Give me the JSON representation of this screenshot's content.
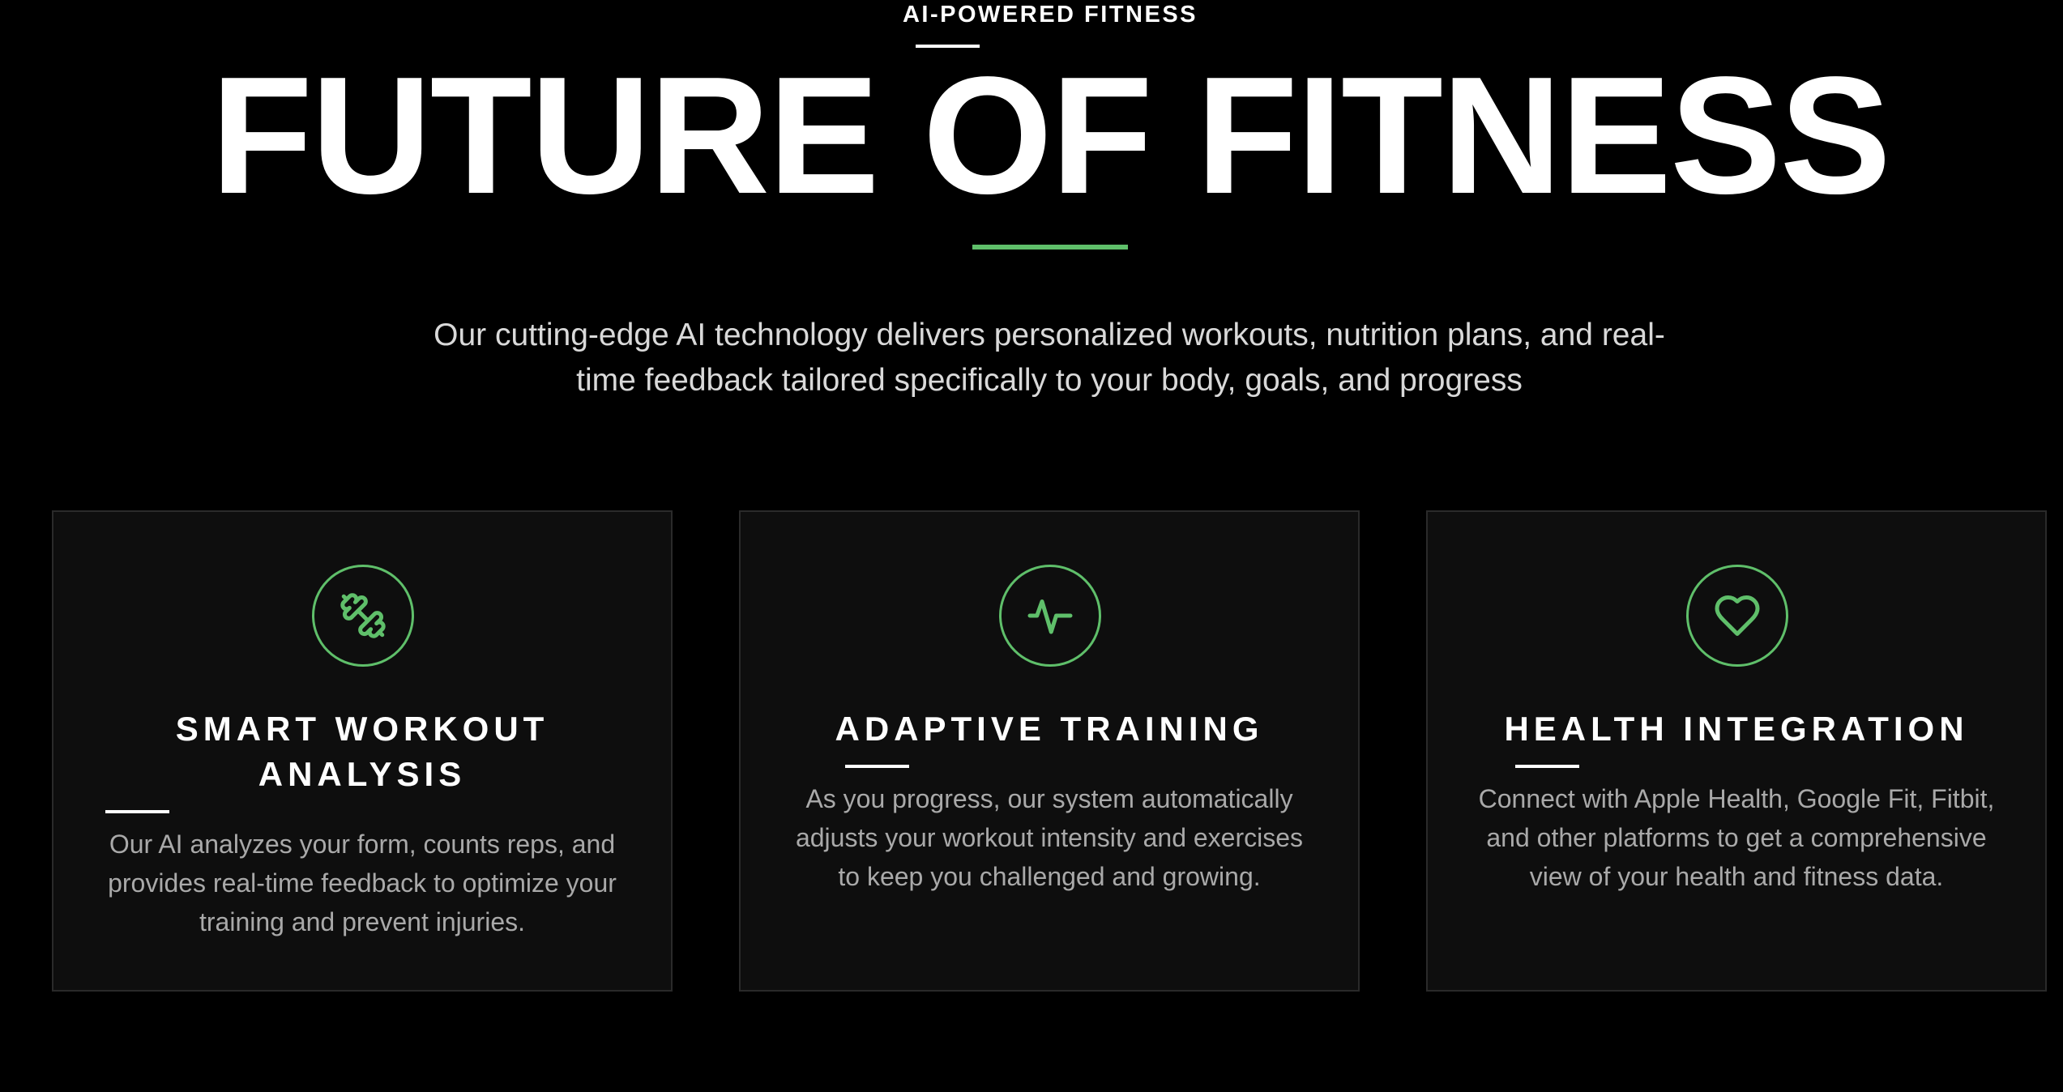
{
  "hero": {
    "eyebrow": "AI-POWERED FITNESS",
    "title": "FUTURE OF FITNESS",
    "description": "Our cutting-edge AI technology delivers personalized workouts, nutrition plans, and real-time feedback tailored specifically to your body, goals, and progress"
  },
  "features": [
    {
      "icon": "dumbbell-icon",
      "title": "SMART WORKOUT ANALYSIS",
      "description": "Our AI analyzes your form, counts reps, and provides real-time feedback to optimize your training and prevent injuries."
    },
    {
      "icon": "activity-pulse-icon",
      "title": "ADAPTIVE TRAINING",
      "description": "As you progress, our system automatically adjusts your workout intensity and exercises to keep you challenged and growing."
    },
    {
      "icon": "heart-icon",
      "title": "HEALTH INTEGRATION",
      "description": "Connect with Apple Health, Google Fit, Fitbit, and other platforms to get a comprehensive view of your health and fitness data."
    }
  ],
  "colors": {
    "background": "#000000",
    "accent": "#5fbf6a",
    "card_background": "#0e0e0e",
    "card_border": "#2a2a2a",
    "body_text": "#a9a9a9"
  }
}
